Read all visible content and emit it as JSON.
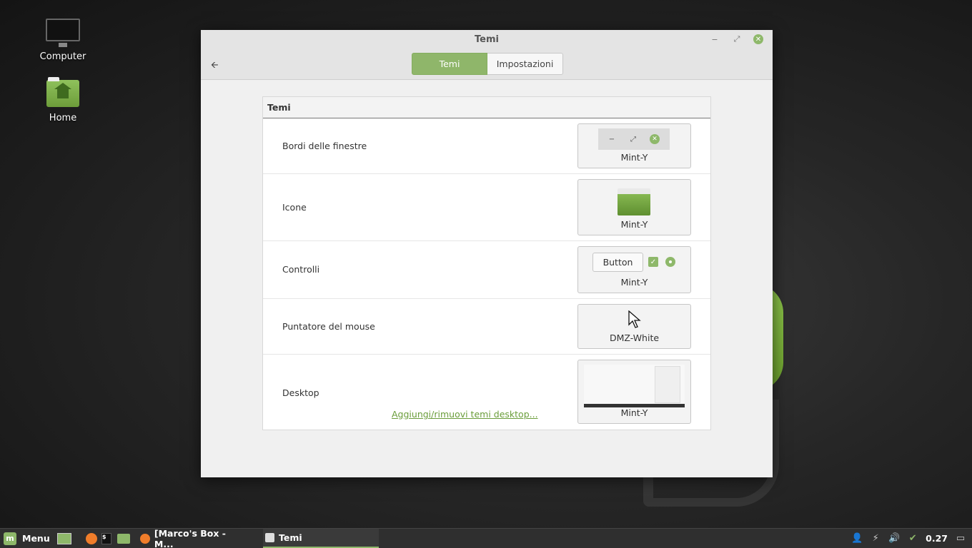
{
  "desktop": {
    "icons": [
      {
        "label": "Computer"
      },
      {
        "label": "Home"
      }
    ]
  },
  "window": {
    "title": "Temi",
    "controls": {
      "minimize": "−",
      "maximize": "⤢",
      "close": "✕"
    },
    "back": "🡨",
    "tabs": [
      {
        "label": "Temi",
        "active": true
      },
      {
        "label": "Impostazioni",
        "active": false
      }
    ]
  },
  "panel": {
    "heading": "Temi",
    "rows": [
      {
        "label": "Bordi delle finestre",
        "theme": "Mint-Y"
      },
      {
        "label": "Icone",
        "theme": "Mint-Y"
      },
      {
        "label": "Controlli",
        "theme": "Mint-Y",
        "button_sample": "Button"
      },
      {
        "label": "Puntatore del mouse",
        "theme": "DMZ-White"
      },
      {
        "label": "Desktop",
        "theme": "Mint-Y",
        "link": "Aggiungi/rimuovi temi desktop..."
      }
    ]
  },
  "taskbar": {
    "menu_label": "Menu",
    "windows": [
      {
        "label": "[Marco's Box - M..."
      },
      {
        "label": "Temi"
      }
    ],
    "clock": "0.27"
  },
  "colors": {
    "accent": "#8eb86a",
    "link": "#6a9d3a"
  }
}
